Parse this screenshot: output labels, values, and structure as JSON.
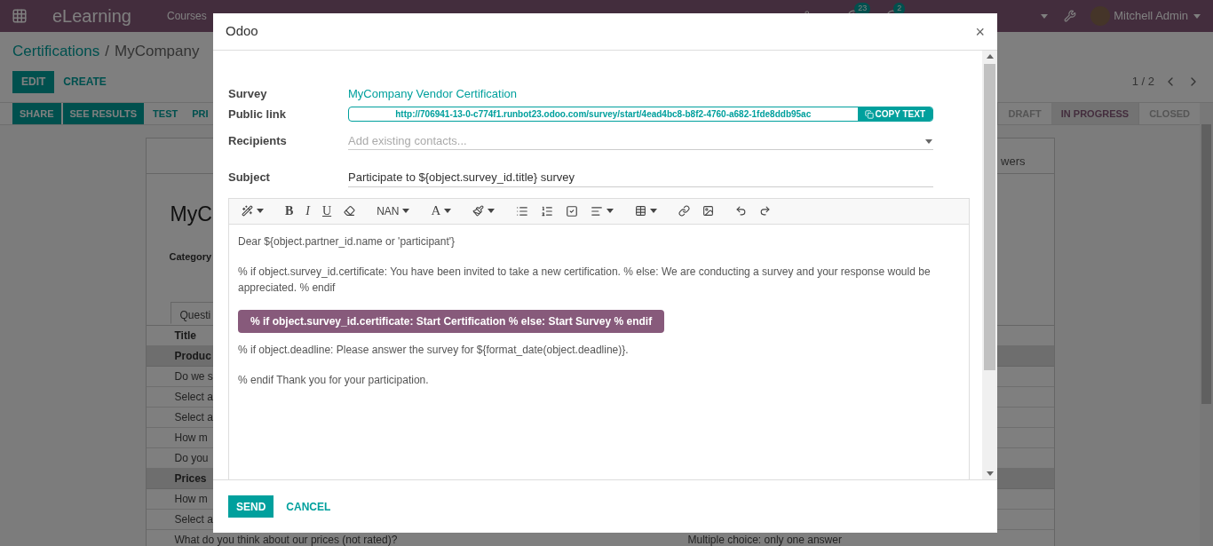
{
  "navbar": {
    "app_name": "eLearning",
    "menu": [
      "Courses"
    ],
    "activity_count": "23",
    "message_count": "2",
    "user": "Mitchell Admin"
  },
  "control_panel": {
    "breadcrumb": [
      "Certifications",
      "MyCompany"
    ],
    "separator": "/",
    "buttons": [
      "EDIT",
      "CREATE"
    ],
    "pager": "1 / 2"
  },
  "header_buttons": [
    {
      "label": "SHARE",
      "primary": true
    },
    {
      "label": "SEE RESULTS",
      "primary": true
    },
    {
      "label": "TEST",
      "primary": false
    },
    {
      "label": "PRI",
      "primary": false
    }
  ],
  "stages": [
    {
      "label": "DRAFT",
      "selected": false
    },
    {
      "label": "IN PROGRESS",
      "selected": true
    },
    {
      "label": "CLOSED",
      "selected": false
    }
  ],
  "sheet": {
    "smart_button": "wers",
    "title": "MyC",
    "field_label": "Category",
    "tab": "Questi",
    "column": "Title",
    "rows": [
      {
        "kind": "section",
        "title": "Produc"
      },
      {
        "kind": "question",
        "title": "Do we s"
      },
      {
        "kind": "question",
        "title": "Select a"
      },
      {
        "kind": "question",
        "title": "Select a"
      },
      {
        "kind": "question",
        "title": "How m"
      },
      {
        "kind": "question",
        "title": "Do you"
      },
      {
        "kind": "section",
        "title": "Prices"
      },
      {
        "kind": "question",
        "title": "How m"
      },
      {
        "kind": "question",
        "title": "Select a"
      },
      {
        "kind": "question",
        "title": "What do you think about our prices (not rated)?",
        "type": "Multiple choice: only one answer"
      }
    ]
  },
  "dialog": {
    "title": "Odoo",
    "close": "×",
    "survey": {
      "label": "Survey",
      "value": "MyCompany Vendor Certification"
    },
    "public_link": {
      "label": "Public link",
      "value": "http://706941-13-0-c774f1.runbot23.odoo.com/survey/start/4ead4bc8-b8f2-4760-a682-1fde8ddb95ac",
      "copy": "COPY TEXT"
    },
    "recipients": {
      "label": "Recipients",
      "placeholder": "Add existing contacts..."
    },
    "subject": {
      "label": "Subject",
      "value": "Participate to ${object.survey_id.title} survey"
    },
    "toolbar": {
      "bold": "B",
      "italic": "I",
      "underline": "U",
      "font_size": "NAN",
      "font_color": "A"
    },
    "body": [
      {
        "kind": "text",
        "text": "Dear ${object.partner_id.name or 'participant'}"
      },
      {
        "kind": "text",
        "text": "% if object.survey_id.certificate: You have been invited to take a new certification. % else: We are conducting a survey and your response would be appreciated. % endif"
      },
      {
        "kind": "button",
        "text": "% if object.survey_id.certificate: Start Certification % else: Start Survey % endif"
      },
      {
        "kind": "text",
        "text": "% if object.deadline: Please answer the survey for ${format_date(object.deadline)}."
      },
      {
        "kind": "text",
        "text": "% endif Thank you for your participation."
      }
    ],
    "buttons": [
      {
        "label": "SEND",
        "primary": true
      },
      {
        "label": "CANCEL",
        "primary": false
      }
    ]
  }
}
